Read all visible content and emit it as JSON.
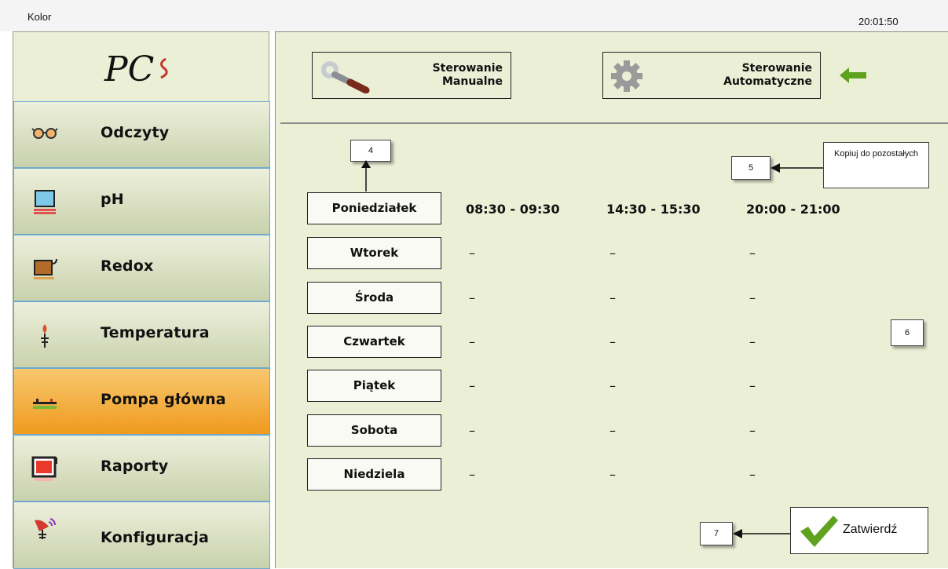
{
  "window": {
    "title": "Kolor",
    "clock": "20:01:50"
  },
  "logo": {
    "text": "PC"
  },
  "sidebar": {
    "items": [
      {
        "label": "Odczyty",
        "icon": "glasses-icon",
        "active": false
      },
      {
        "label": "pH",
        "icon": "beaker-icon",
        "active": false
      },
      {
        "label": "Redox",
        "icon": "kettle-icon",
        "active": false
      },
      {
        "label": "Temperatura",
        "icon": "thermometer-icon",
        "active": false
      },
      {
        "label": "Pompa główna",
        "icon": "pump-icon",
        "active": true
      },
      {
        "label": "Raporty",
        "icon": "monitor-icon",
        "active": false
      },
      {
        "label": "Konfiguracja",
        "icon": "satellite-dish-icon",
        "active": false
      }
    ]
  },
  "toolbar": {
    "manual_line1": "Sterowanie",
    "manual_line2": "Manualne",
    "auto_line1": "Sterowanie",
    "auto_line2": "Automatyczne"
  },
  "schedule": {
    "days": [
      "Poniedziałek",
      "Wtorek",
      "Środa",
      "Czwartek",
      "Piątek",
      "Sobota",
      "Niedziela"
    ],
    "slots": [
      "08:30 - 09:30",
      "14:30 - 15:30",
      "20:00 - 21:00"
    ],
    "empty": "–"
  },
  "annotations": {
    "n4": "4",
    "n5": "5",
    "n6": "6",
    "n7": "7",
    "copy_note": "Kopiuj do pozostałych"
  },
  "confirm": {
    "label": "Zatwierdź"
  },
  "colors": {
    "panel": "#ebefd6",
    "active": "#f2a32c",
    "accent_green": "#5ea21e",
    "nav_border": "#6fa9cf"
  }
}
